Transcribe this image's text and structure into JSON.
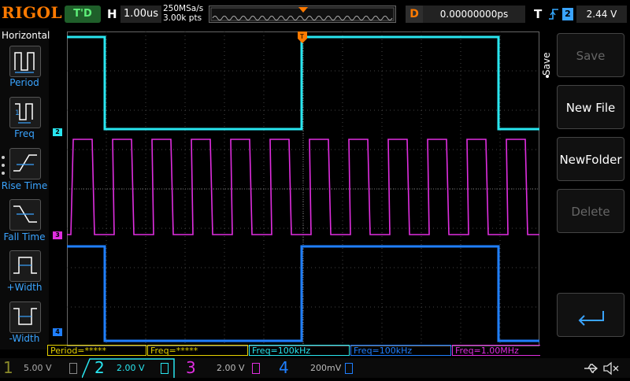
{
  "header": {
    "brand": "RIGOL",
    "run_state": "T'D",
    "timebase_label": "H",
    "timebase_value": "1.00us",
    "sample_rate": "250MSa/s",
    "memory_depth": "3.00k pts",
    "delay_label": "D",
    "delay_value": "0.00000000ps",
    "trigger_label": "T",
    "trigger_channel": "2",
    "trigger_level": "2.44 V"
  },
  "left_menu": {
    "title": "Horizontal",
    "items": [
      {
        "label": "Period",
        "icon": "period-icon"
      },
      {
        "label": "Freq",
        "icon": "frequency-icon"
      },
      {
        "label": "Rise Time",
        "icon": "rise-time-icon"
      },
      {
        "label": "Fall Time",
        "icon": "fall-time-icon"
      },
      {
        "label": "+Width",
        "icon": "positive-width-icon"
      },
      {
        "label": "-Width",
        "icon": "negative-width-icon"
      }
    ]
  },
  "right_menu": {
    "title": "Save",
    "items": [
      {
        "label": "Save",
        "enabled": false
      },
      {
        "label": "New File",
        "enabled": true
      },
      {
        "label": "NewFolder",
        "enabled": true
      },
      {
        "label": "Delete",
        "enabled": false
      },
      {
        "label": "",
        "icon": "return-icon",
        "enabled": true
      }
    ]
  },
  "measurements": [
    {
      "label": "Period=*****",
      "color": "#e5d100"
    },
    {
      "label": "Freq=*****",
      "color": "#e5d100"
    },
    {
      "label": "Freq=100kHz",
      "color": "#29e6f0"
    },
    {
      "label": "Freq=100kHz",
      "color": "#1f7fff"
    },
    {
      "label": "Freq=1.00MHz",
      "color": "#e02ee0"
    }
  ],
  "channels": [
    {
      "num": "1",
      "scale": "5.00 V",
      "color": "#8a8a2a",
      "active": false
    },
    {
      "num": "2",
      "scale": "2.00 V",
      "color": "#29e6f0",
      "active": true
    },
    {
      "num": "3",
      "scale": "2.00 V",
      "color": "#e02ee0",
      "active": false
    },
    {
      "num": "4",
      "scale": "200mV",
      "color": "#1f7fff",
      "active": false
    }
  ],
  "markers": {
    "ch2": "2",
    "ch3": "3",
    "ch4": "4",
    "trigger_pos": "T"
  },
  "waveforms": {
    "ch2": {
      "color": "#29e6f0",
      "freq": "100kHz",
      "duty": 0.5
    },
    "ch3": {
      "color": "#e02ee0",
      "freq": "1.00MHz"
    },
    "ch4": {
      "color": "#1f7fff",
      "freq": "100kHz",
      "duty": 0.5
    }
  },
  "status_icons": [
    "usb-icon",
    "speaker-muted-icon"
  ]
}
